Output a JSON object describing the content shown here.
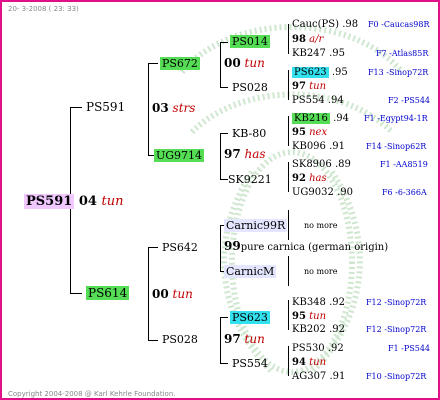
{
  "header_date": "20-  3-2008 ( 23: 33)",
  "footer": "Copyright 2004-2008 @ Karl Kehrle Foundation.",
  "root": {
    "id": "PS591",
    "year": "04",
    "breed": "tun"
  },
  "mother": {
    "id": "PS591"
  },
  "father": {
    "id": "PS614",
    "year": "00",
    "breed": "tun"
  },
  "mm": {
    "id": "PS672",
    "year": "03",
    "breed": "strs"
  },
  "mf": {
    "id": "UG9714",
    "year": "97",
    "breed": "has"
  },
  "fm": {
    "id": "PS642",
    "year": "99",
    "breed": "pure carnica (german origin)"
  },
  "ff": {
    "id": "PS028",
    "year": "97",
    "breed": "tun"
  },
  "g3": {
    "ps014": {
      "id": "PS014",
      "year": "00",
      "breed": "tun"
    },
    "ps028a": {
      "id": "PS028"
    },
    "kb80": {
      "id": "KB-80",
      "year": "95",
      "breed": "nex"
    },
    "sk9221": {
      "id": "SK9221"
    },
    "carnic99r": {
      "id": "Carnic99R"
    },
    "carnicm": {
      "id": "CarnicM"
    },
    "ps623": {
      "id": "PS623",
      "year": "95",
      "breed": "tun"
    },
    "ps554": {
      "id": "PS554",
      "year": "94",
      "breed": "tun"
    }
  },
  "g4": [
    {
      "id": "Cauc(PS)",
      "yr": ".98",
      "code": "F0 -Caucas98R"
    },
    {
      "mid": "98",
      "breed": "a/r"
    },
    {
      "id": "KB247",
      "yr": ".95",
      "code": "F7 -Atlas85R"
    },
    {
      "id": "PS623",
      "yr": ".95",
      "code": "F13 -Sinop72R"
    },
    {
      "mid": "97",
      "breed": "tun"
    },
    {
      "id": "PS554",
      "yr": ".94",
      "code": "F2 -PS544"
    },
    {
      "id": "KB216",
      "yr": ".94",
      "code": "F1 -Egypt94-1R"
    },
    {
      "id": "KB096",
      "yr": ".91",
      "code": "F14 -Sinop62R"
    },
    {
      "id": "SK8906",
      "yr": ".89",
      "code": "F1 -AA8519"
    },
    {
      "mid": "92",
      "breed": "has"
    },
    {
      "id": "UG9032",
      "yr": ".90",
      "code": "F6 -6-366A"
    },
    {
      "nomore": "no more"
    },
    {
      "nomore": "no more"
    },
    {
      "id": "KB348",
      "yr": ".92",
      "code": "F12 -Sinop72R"
    },
    {
      "id": "KB202",
      "yr": ".92",
      "code": "F12 -Sinop72R"
    },
    {
      "id": "PS530",
      "yr": ".92",
      "code": "F1 -PS544"
    },
    {
      "id": "AG307",
      "yr": ".91",
      "code": "F10 -Sinop72R"
    }
  ]
}
